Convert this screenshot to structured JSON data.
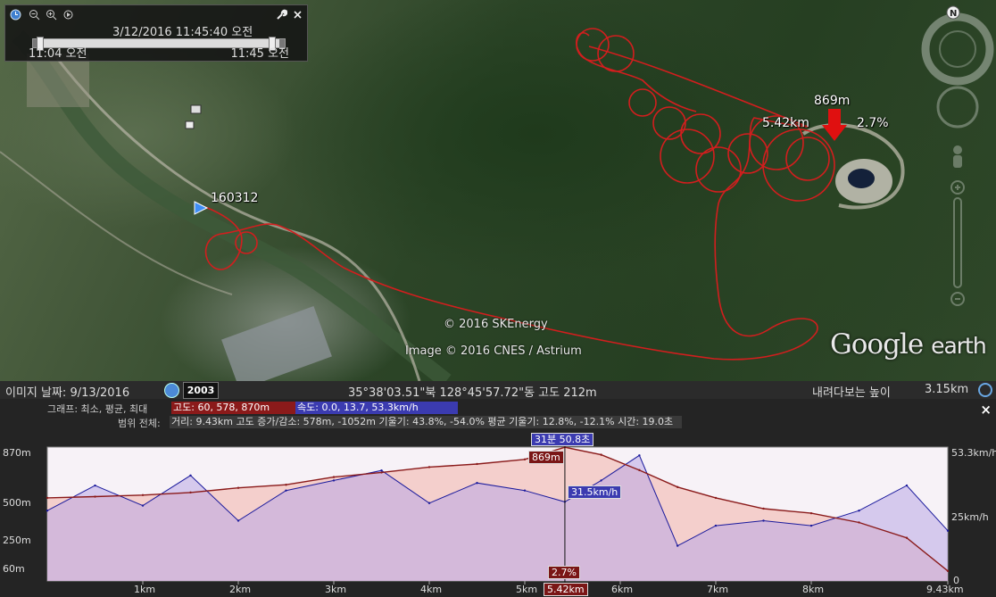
{
  "time_slider": {
    "current": "3/12/2016  11:45:40 오전",
    "start": "11:04 오전",
    "end": "11:45 오전",
    "icons": [
      "clock-icon",
      "zoom-out-icon",
      "zoom-in-icon",
      "animate-icon",
      "wrench-icon",
      "close-icon"
    ]
  },
  "map": {
    "track_label": "160312",
    "elevation_label": "869m",
    "distance_label": "5.42km",
    "slope_label": "2.7%",
    "copyright_1": "© 2016 SKEnergy",
    "copyright_2": "Image © 2016 CNES / Astrium",
    "logo_google": "Google",
    "logo_earth": "earth",
    "north_label": "N",
    "colors": {
      "track": "#d21e1e",
      "marker": "#e01010"
    }
  },
  "status_bar": {
    "image_date": "이미지 날짜: 9/13/2016",
    "year": "2003",
    "coords": "35°38'03.51\"북 128°45'57.72\"동 고도   212m",
    "eye_label": "내려다보는 높이",
    "eye_value": "3.15km"
  },
  "profile": {
    "header_label": "그래프: 최소, 평균, 최대",
    "elev_stats": "고도: 60, 578, 870m",
    "speed_stats": "속도: 0.0, 13.7, 53.3km/h",
    "range_label": "범위 전체:",
    "range_stats": "거리: 9.43km 고도 증가/감소: 578m, -1052m 기울기: 43.8%, -54.0% 평균 기울기: 12.8%, -12.1% 시간: 19.0초",
    "close_label": "×",
    "y_left": [
      "870m",
      "500m",
      "250m",
      "60m"
    ],
    "y_right": [
      "53.3km/h",
      "25km/h",
      "0"
    ],
    "x_ticks": [
      "1km",
      "2km",
      "3km",
      "4km",
      "5km",
      "6km",
      "7km",
      "8km",
      "9.43km"
    ],
    "cursor": {
      "time": "31분 50.8초",
      "elevation": "869m",
      "speed": "31.5km/h",
      "slope": "2.7%",
      "distance": "5.42km"
    },
    "colors": {
      "elevation_fill": "#f3c6c0",
      "elevation_line": "#8a1a1a",
      "speed_line": "#1a1a9c",
      "speed_fill": "#b9a8e6"
    }
  },
  "chart_data": {
    "type": "area",
    "xlabel": "",
    "ylabel": "",
    "xlim": [
      0,
      9.43
    ],
    "x": [
      0,
      0.5,
      1,
      1.5,
      2,
      2.5,
      3,
      3.5,
      4,
      4.5,
      5,
      5.42,
      5.8,
      6.2,
      6.6,
      7,
      7.5,
      8,
      8.5,
      9,
      9.43
    ],
    "series": [
      {
        "name": "고도",
        "unit": "m",
        "ylim": [
          60,
          870
        ],
        "values": [
          540,
          548,
          558,
          575,
          605,
          625,
          675,
          705,
          740,
          760,
          790,
          869,
          820,
          720,
          610,
          540,
          470,
          440,
          380,
          280,
          65
        ]
      },
      {
        "name": "속도",
        "unit": "km/h",
        "ylim": [
          0,
          53.3
        ],
        "values": [
          28,
          38,
          30,
          42,
          24,
          36,
          40,
          44,
          31,
          39,
          36,
          31.5,
          40,
          50,
          14,
          22,
          24,
          22,
          28,
          38,
          20
        ]
      }
    ]
  }
}
